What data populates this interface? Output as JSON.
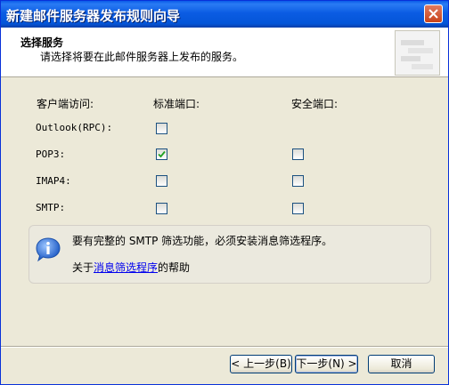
{
  "window": {
    "title": "新建邮件服务器发布规则向导"
  },
  "header": {
    "title": "选择服务",
    "subtitle": "请选择将要在此邮件服务器上发布的服务。"
  },
  "columns": {
    "client": "客户端访问:",
    "standard": "标准端口:",
    "secure": "安全端口:"
  },
  "services": [
    {
      "name": "Outlook(RPC):",
      "standard": false,
      "secure": null
    },
    {
      "name": "POP3:",
      "standard": true,
      "secure": false
    },
    {
      "name": "IMAP4:",
      "standard": false,
      "secure": false
    },
    {
      "name": "SMTP:",
      "standard": false,
      "secure": false
    }
  ],
  "info": {
    "message": "要有完整的 SMTP 筛选功能，必须安装消息筛选程序。",
    "help_prefix": "关于",
    "help_link": "消息筛选程序",
    "help_suffix": "的帮助"
  },
  "buttons": {
    "back": "< 上一步(B)",
    "next": "下一步(N) >",
    "cancel": "取消"
  },
  "colors": {
    "titlebar": "#0a5ce8",
    "dialog_bg": "#ece9d8",
    "check": "#21a121",
    "link": "#0000ee"
  }
}
